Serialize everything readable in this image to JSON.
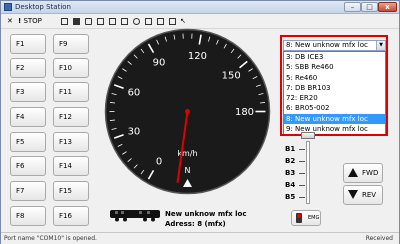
{
  "window": {
    "title": "Desktop Station"
  },
  "toolbar": {
    "close_all": "✕",
    "stop_label": "STOP"
  },
  "function_buttons": [
    "F1",
    "F2",
    "F3",
    "F4",
    "F5",
    "F6",
    "F7",
    "F8",
    "F9",
    "F10",
    "F11",
    "F12",
    "F13",
    "F14",
    "F15",
    "F16"
  ],
  "gauge": {
    "ticks": [
      "0",
      "30",
      "60",
      "90",
      "120",
      "150",
      "180"
    ],
    "unit": "km/h",
    "direction_letter": "N",
    "max_speed": 180,
    "current_speed": 0
  },
  "loco_selector": {
    "selected": "8: New unknow mfx loc",
    "options": [
      "3: DB ICE3",
      "5: SBB Re460",
      "5: Re460",
      "7: DB BR103",
      "72: ER20",
      "6: BR05-002",
      "8: New unknow mfx loc",
      "9: New unknow mfx loc"
    ],
    "highlighted_index": 6
  },
  "accessory_buttons": [
    "B1",
    "B2",
    "B3",
    "B4",
    "B5"
  ],
  "direction_buttons": {
    "forward": "FWD",
    "reverse": "REV"
  },
  "emergency": {
    "label": "EMG"
  },
  "loco_info": {
    "name": "New unknow mfx loc",
    "address": "Adress: 8 (mfx)"
  },
  "status": {
    "left": "Port name \"COM10\" is opened.",
    "right": "Received"
  },
  "colors": {
    "accent_red": "#e00000",
    "selection_blue": "#3399ff"
  }
}
